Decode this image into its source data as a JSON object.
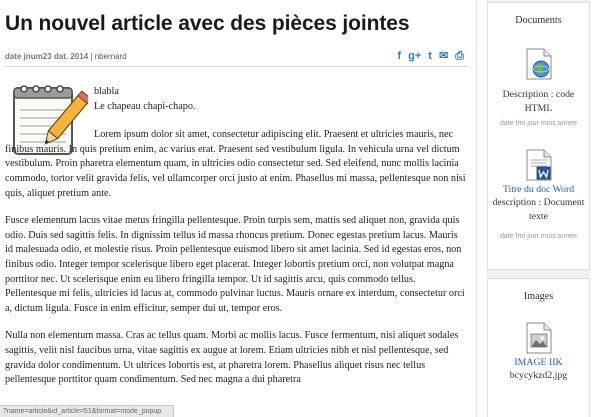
{
  "article": {
    "title": "Un nouvel article avec des pièces jointes",
    "date": "date jnum23 dat. 2014",
    "separator": "|",
    "author": "nbernard",
    "lead_line1": "blabla",
    "lead_line2": "Le chapeau chapi-chapo.",
    "paragraph1": "Lorem ipsum dolor sit amet, consectetur adipiscing elit. Praesent et ultricies mauris, nec finibus mauris. In quis pretium enim, ac varius erat. Praesent sed vestibulum ligula. In vehicula urna vel dictum vestibulum. Proin pharetra elementum quam, in ultricies odio consectetur sed. Sed eleifend, nunc mollis lacinia commodo, tortor velit gravida felis, vel ullamcorper orci justo at enim. Phasellus mi massa, pellentesque non nisi quis, aliquet pretium ante.",
    "paragraph2": "Fusce elementum lacus vitae metus fringilla pellentesque. Proin turpis sem, mattis sed aliquet non, gravida quis odio. Duis sed sagittis felis. In dignissim tellus id massa rhoncus pretium. Donec egestas pretium lacus. Mauris id malesuada odio, et molestie risus. Proin pellentesque euismod libero sit amet lacinia. Sed id egestas eros, non finibus odio. Integer tempor scelerisque libero eget placerat. Integer lobortis pretium orci, non volutpat magna porttitor nec. Ut scelerisque enim eu libero fringilla tempor. Ut id sagittis arcu, quis commodo tellus. Pellentesque mi felis, ultricies id lacus at, commodo pulvinar luctus. Mauris ornare ex interdum, consectetur orci a, dictum ligula. Fusce in enim efficitur, semper dui ut, tempor eros.",
    "paragraph3": "Nulla non elementum massa. Cras ac tellus quam. Morbi ac mollis lacus. Fusce fermentum, nisi aliquet sodales sagittis, velit nisl faucibus urna, vitae sagittis ex augue at lorem. Etiam ultricies nibh et nisl pellentesque, sed gravida dolor condimentum. Ut ultrices lobortis est, at pharetra lorem. Phasellus aliquet risus nec tellus pellentesque porttitor quam condimentum. Sed nec magna a dui pharetra"
  },
  "share": {
    "icons": [
      "facebook-icon",
      "google-plus-icon",
      "twitter-icon",
      "email-icon",
      "print-icon"
    ],
    "glyphs": {
      "facebook": "f",
      "google_plus": "g+",
      "twitter": "t",
      "email": "✉",
      "print": "⎙"
    }
  },
  "status_bar": {
    "text": "?name=article&id_article=51&format=mode_popup"
  },
  "sidebar": {
    "documents": {
      "heading": "Documents",
      "items": [
        {
          "icon": "html-globe-icon",
          "description": "Description : code HTML",
          "date": "date fmt jour mois annee"
        },
        {
          "icon": "word-document-icon",
          "title": "Titre du doc Word",
          "description": "description : Document texte",
          "date": "date fmt jour mois annee"
        }
      ]
    },
    "images": {
      "heading": "Images",
      "items": [
        {
          "icon": "image-file-icon",
          "title": "IMAGE IIK",
          "filename": "bcycykzd2.jpg"
        }
      ]
    }
  },
  "colors": {
    "link": "#1d5ea8",
    "share": "#2f7fbf",
    "sidebar_bg": "#f1f1f1"
  }
}
